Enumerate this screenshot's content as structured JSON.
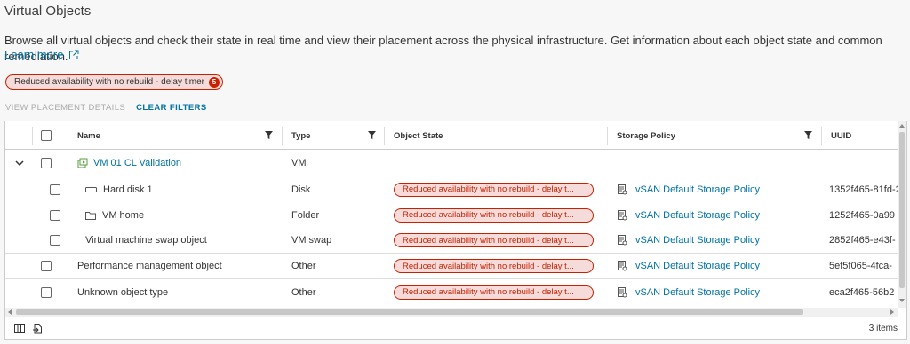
{
  "page": {
    "title": "Virtual Objects",
    "description": "Browse all virtual objects and check their state in real time and view their placement across the physical infrastructure. Get information about each object state and common remediation.",
    "learn_more": "Learn more"
  },
  "filter_chip": {
    "label": "Reduced availability with no rebuild - delay timer",
    "count": "5"
  },
  "actions": {
    "view_placement": "VIEW PLACEMENT DETAILS",
    "clear_filters": "CLEAR FILTERS"
  },
  "columns": {
    "name": "Name",
    "type": "Type",
    "object_state": "Object State",
    "storage_policy": "Storage Policy",
    "uuid": "UUID"
  },
  "rows": [
    {
      "name": "VM 01 CL Validation",
      "type": "VM",
      "state": "",
      "policy": "",
      "uuid": ""
    },
    {
      "name": "Hard disk 1",
      "type": "Disk",
      "state": "Reduced availability with no rebuild - delay t...",
      "policy": "vSAN Default Storage Policy",
      "uuid": "1352f465-81fd-2"
    },
    {
      "name": "VM home",
      "type": "Folder",
      "state": "Reduced availability with no rebuild - delay t...",
      "policy": "vSAN Default Storage Policy",
      "uuid": "1252f465-0a99"
    },
    {
      "name": "Virtual machine swap object",
      "type": "VM swap",
      "state": "Reduced availability with no rebuild - delay t...",
      "policy": "vSAN Default Storage Policy",
      "uuid": "2852f465-e43f-"
    },
    {
      "name": "Performance management object",
      "type": "Other",
      "state": "Reduced availability with no rebuild - delay t...",
      "policy": "vSAN Default Storage Policy",
      "uuid": "5ef5f065-4fca-"
    },
    {
      "name": "Unknown object type",
      "type": "Other",
      "state": "Reduced availability with no rebuild - delay t...",
      "policy": "vSAN Default Storage Policy",
      "uuid": "eca2f465-56b2"
    }
  ],
  "footer": {
    "items_count": "3 items"
  },
  "colors": {
    "link": "#0072a3",
    "danger": "#c92100",
    "danger_bg": "#f5dbd9"
  }
}
